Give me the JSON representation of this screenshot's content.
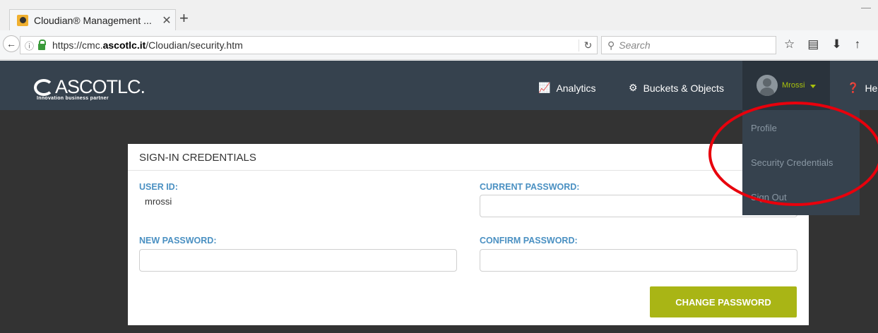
{
  "browser": {
    "tab_title": "Cloudian® Management ...",
    "tab_close": "✕",
    "new_tab": "+",
    "url_prefix": "https://cmc.",
    "url_domain": "ascotlc.it",
    "url_suffix": "/Cloudian/security.htm",
    "search_placeholder": "Search"
  },
  "app": {
    "logo_text": "ASCOTLC.",
    "logo_tagline": "Innovation business partner",
    "nav": {
      "analytics": "Analytics",
      "buckets": "Buckets & Objects",
      "help": "He"
    },
    "user": "Mrossi",
    "dropdown": [
      "Profile",
      "Security Credentials",
      "Sign Out"
    ]
  },
  "form": {
    "title": "SIGN-IN CREDENTIALS",
    "user_id_label": "USER ID:",
    "user_id_value": "mrossi",
    "current_password_label": "CURRENT PASSWORD:",
    "new_password_label": "NEW PASSWORD:",
    "confirm_password_label": "CONFIRM PASSWORD:",
    "change_button": "CHANGE PASSWORD"
  },
  "colors": {
    "header_bg": "#36424e",
    "accent_green": "#a9b515",
    "label_blue": "#4a90c2",
    "annotation_red": "#e8000c"
  }
}
